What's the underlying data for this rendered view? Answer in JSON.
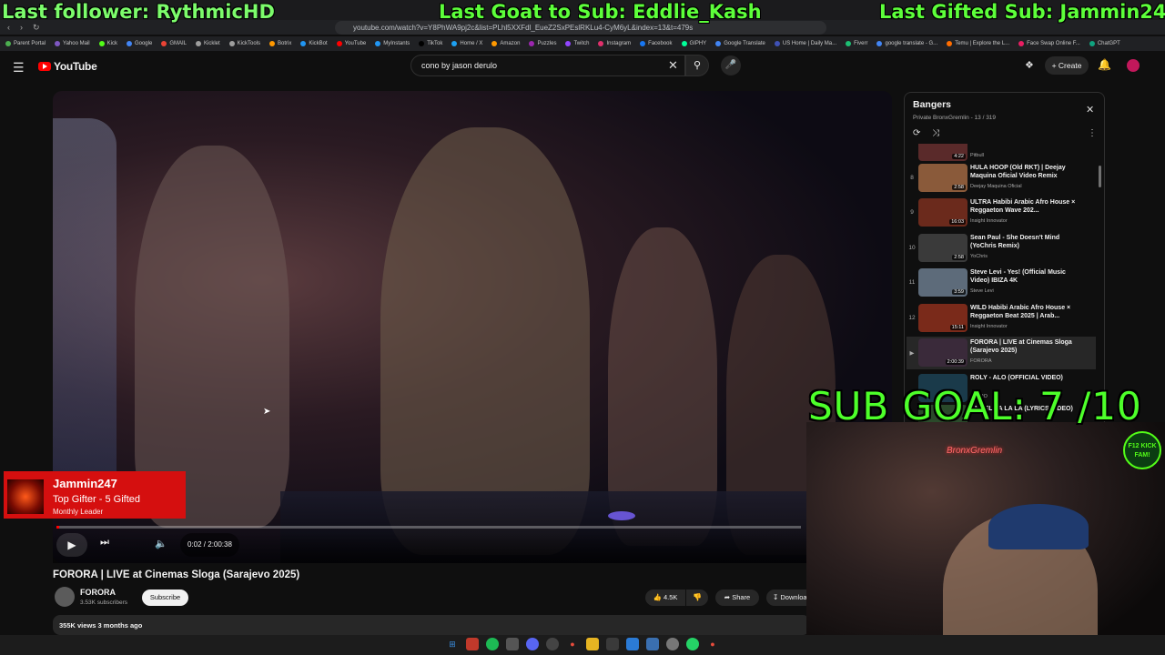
{
  "overlay": {
    "last_follower": "Last follower: RythmicHD",
    "last_goat": "Last Goat to Sub: Eddlie_Kash",
    "last_gifted": "Last Gifted Sub: Jammin247",
    "sub_goal": "SUB GOAL: 7 /10",
    "kick_badge": "F12 KICK FAM!",
    "neon_sign": "BronxGremlin",
    "gifter": {
      "name": "Jammin247",
      "role": "Top Gifter - 5 Gifted",
      "sub": "Monthly Leader"
    }
  },
  "browser": {
    "url": "youtube.com/watch?v=Y8PhWA9pj2c&list=PLhl5XXFdl_EueZ2SxPEslRKLu4-CyM6yL&index=13&t=479s",
    "bookmarks": [
      "Parent Portal",
      "Yahoo Mail",
      "Kick",
      "Google",
      "GMAIL",
      "Kicklet",
      "KickTools",
      "Botrix",
      "KickBot",
      "YouTube",
      "MyInstants",
      "TikTok",
      "Home / X",
      "Amazon",
      "Puzzles",
      "Twitch",
      "Instagram",
      "Facebook",
      "GIPHY",
      "Google Translate",
      "US Home | Daily Ma...",
      "Fiverr",
      "google translate - G...",
      "Temu | Explore the L...",
      "Face Swap Online F...",
      "ChatGPT"
    ]
  },
  "youtube": {
    "logo": "YouTube",
    "search_value": "cono by jason derulo",
    "create_label": "Create",
    "player": {
      "time": "0:02 / 2:00:38",
      "progress": 0.0003
    },
    "video": {
      "title": "FORORA | LIVE at Cinemas Sloga (Sarajevo 2025)",
      "channel": "FORORA",
      "subs": "3.53K subscribers",
      "subscribe_label": "Subscribe",
      "likes": "4.5K",
      "share_label": "Share",
      "download_label": "Download",
      "views_line": "355K views  3 months ago"
    },
    "playlist": {
      "title": "Bangers",
      "meta": "Private  BronxGremlin - 13 / 319",
      "items": [
        {
          "idx": "",
          "title": "@LAMELIJOE YT II...",
          "channel": "Pitbull",
          "duration": "4:22",
          "color": "#5a2a2a"
        },
        {
          "idx": "8",
          "title": "HULA HOOP (Old RKT) | Deejay Maquina Oficial Video Remix",
          "channel": "Deejay Maquina Oficial",
          "duration": "2:58",
          "color": "#8a5a3a"
        },
        {
          "idx": "9",
          "title": "ULTRA Habibi Arabic Afro House × Reggaeton Wave 202...",
          "channel": "Insight Innovator",
          "duration": "16:03",
          "color": "#6b2a1c"
        },
        {
          "idx": "10",
          "title": "Sean Paul - She Doesn't Mind (YoChris Remix)",
          "channel": "YoChris",
          "duration": "2:58",
          "color": "#3a3a3a"
        },
        {
          "idx": "11",
          "title": "Steve Levi - Yes! (Official Music Video) IBIZA 4K",
          "channel": "Steve Levi",
          "duration": "3:59",
          "color": "#5d6b7a"
        },
        {
          "idx": "12",
          "title": "WILD Habibi Arabic Afro House × Reggaeton Beat 2025 | Arab...",
          "channel": "Insight Innovator",
          "duration": "15:11",
          "color": "#7a2a1a"
        },
        {
          "idx": "▶",
          "title": "FORORA | LIVE at Cinemas Sloga (Sarajevo 2025)",
          "channel": "FORORA",
          "duration": "2:00:39",
          "color": "#3a2a3a"
        },
        {
          "idx": "",
          "title": "ROLY - ALO (OFFICIAL VIDEO)",
          "channel": "ASTRO",
          "duration": "",
          "color": "#1a3a4a"
        },
        {
          "idx": "",
          "title": "ANGEL LA LA LA (LYRICS VIDEO)",
          "channel": "",
          "duration": "",
          "color": "#2a4a2a"
        }
      ]
    }
  }
}
